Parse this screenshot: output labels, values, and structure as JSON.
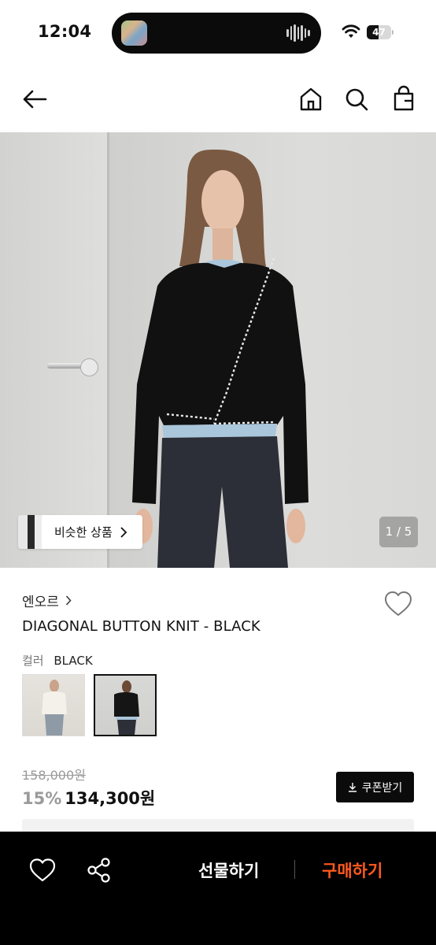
{
  "status_bar": {
    "time": "12:04",
    "battery_level": "47",
    "battery_fraction": 0.47,
    "icons": [
      "wifi-icon",
      "battery-icon",
      "audio-wave-icon"
    ]
  },
  "header": {
    "icons": [
      "back-arrow-icon",
      "home-icon",
      "search-icon",
      "shopping-bag-icon"
    ]
  },
  "gallery": {
    "similar_label": "비슷한 상품",
    "counter": "1 / 5"
  },
  "product": {
    "brand": "엔오르",
    "title": "DIAGONAL BUTTON KNIT - BLACK",
    "color_label": "컬러",
    "color_value": "BLACK",
    "swatches": [
      "ivory",
      "black"
    ],
    "selected_swatch": "black",
    "original_price": "158,000원",
    "discount": "15%",
    "final_price": "134,300원",
    "coupon_label": "쿠폰받기"
  },
  "bottom_bar": {
    "gift_label": "선물하기",
    "buy_label": "구매하기"
  },
  "colors": {
    "accent": "#ff5a1f",
    "bar_bg": "#000000",
    "text": "#111111",
    "muted": "#9a9a9a"
  }
}
